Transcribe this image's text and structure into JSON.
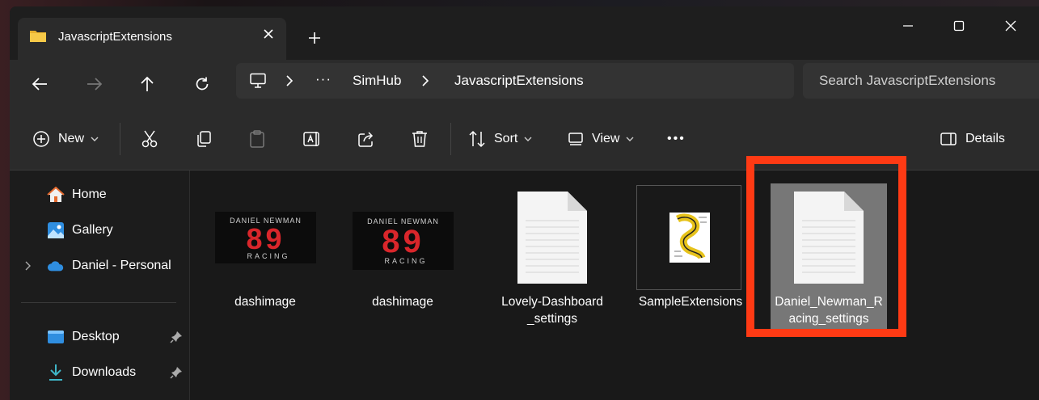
{
  "tab": {
    "title": "JavascriptExtensions"
  },
  "address": {
    "more": "···",
    "segments": [
      "SimHub",
      "JavascriptExtensions"
    ]
  },
  "search": {
    "placeholder": "Search JavascriptExtensions"
  },
  "commands": {
    "new": "New",
    "sort": "Sort",
    "view": "View",
    "more": "•••",
    "details": "Details"
  },
  "sidebar": {
    "items": [
      {
        "label": "Home",
        "icon": "home-icon"
      },
      {
        "label": "Gallery",
        "icon": "gallery-icon"
      },
      {
        "label": "Daniel - Personal",
        "icon": "cloud-icon"
      },
      {
        "label": "Desktop",
        "icon": "desktop-icon"
      },
      {
        "label": "Downloads",
        "icon": "download-icon"
      }
    ]
  },
  "files": [
    {
      "name": "dashimage",
      "type": "image",
      "logo": {
        "top": "DANIEL NEWMAN",
        "number": "89",
        "bottom": "RACING"
      }
    },
    {
      "name": "dashimage",
      "type": "image",
      "logo": {
        "top": "DANIEL NEWMAN",
        "number": "89",
        "bottom": "RACING"
      }
    },
    {
      "name": "Lovely-Dashboard_settings",
      "type": "document"
    },
    {
      "name": "SampleExtensions",
      "type": "script"
    },
    {
      "name": "Daniel_Newman_Racing_settings",
      "type": "document",
      "selected": true
    }
  ],
  "colors": {
    "highlight": "#ff3a14",
    "accent": "#4aa3e0",
    "logo_red": "#d9262b"
  }
}
